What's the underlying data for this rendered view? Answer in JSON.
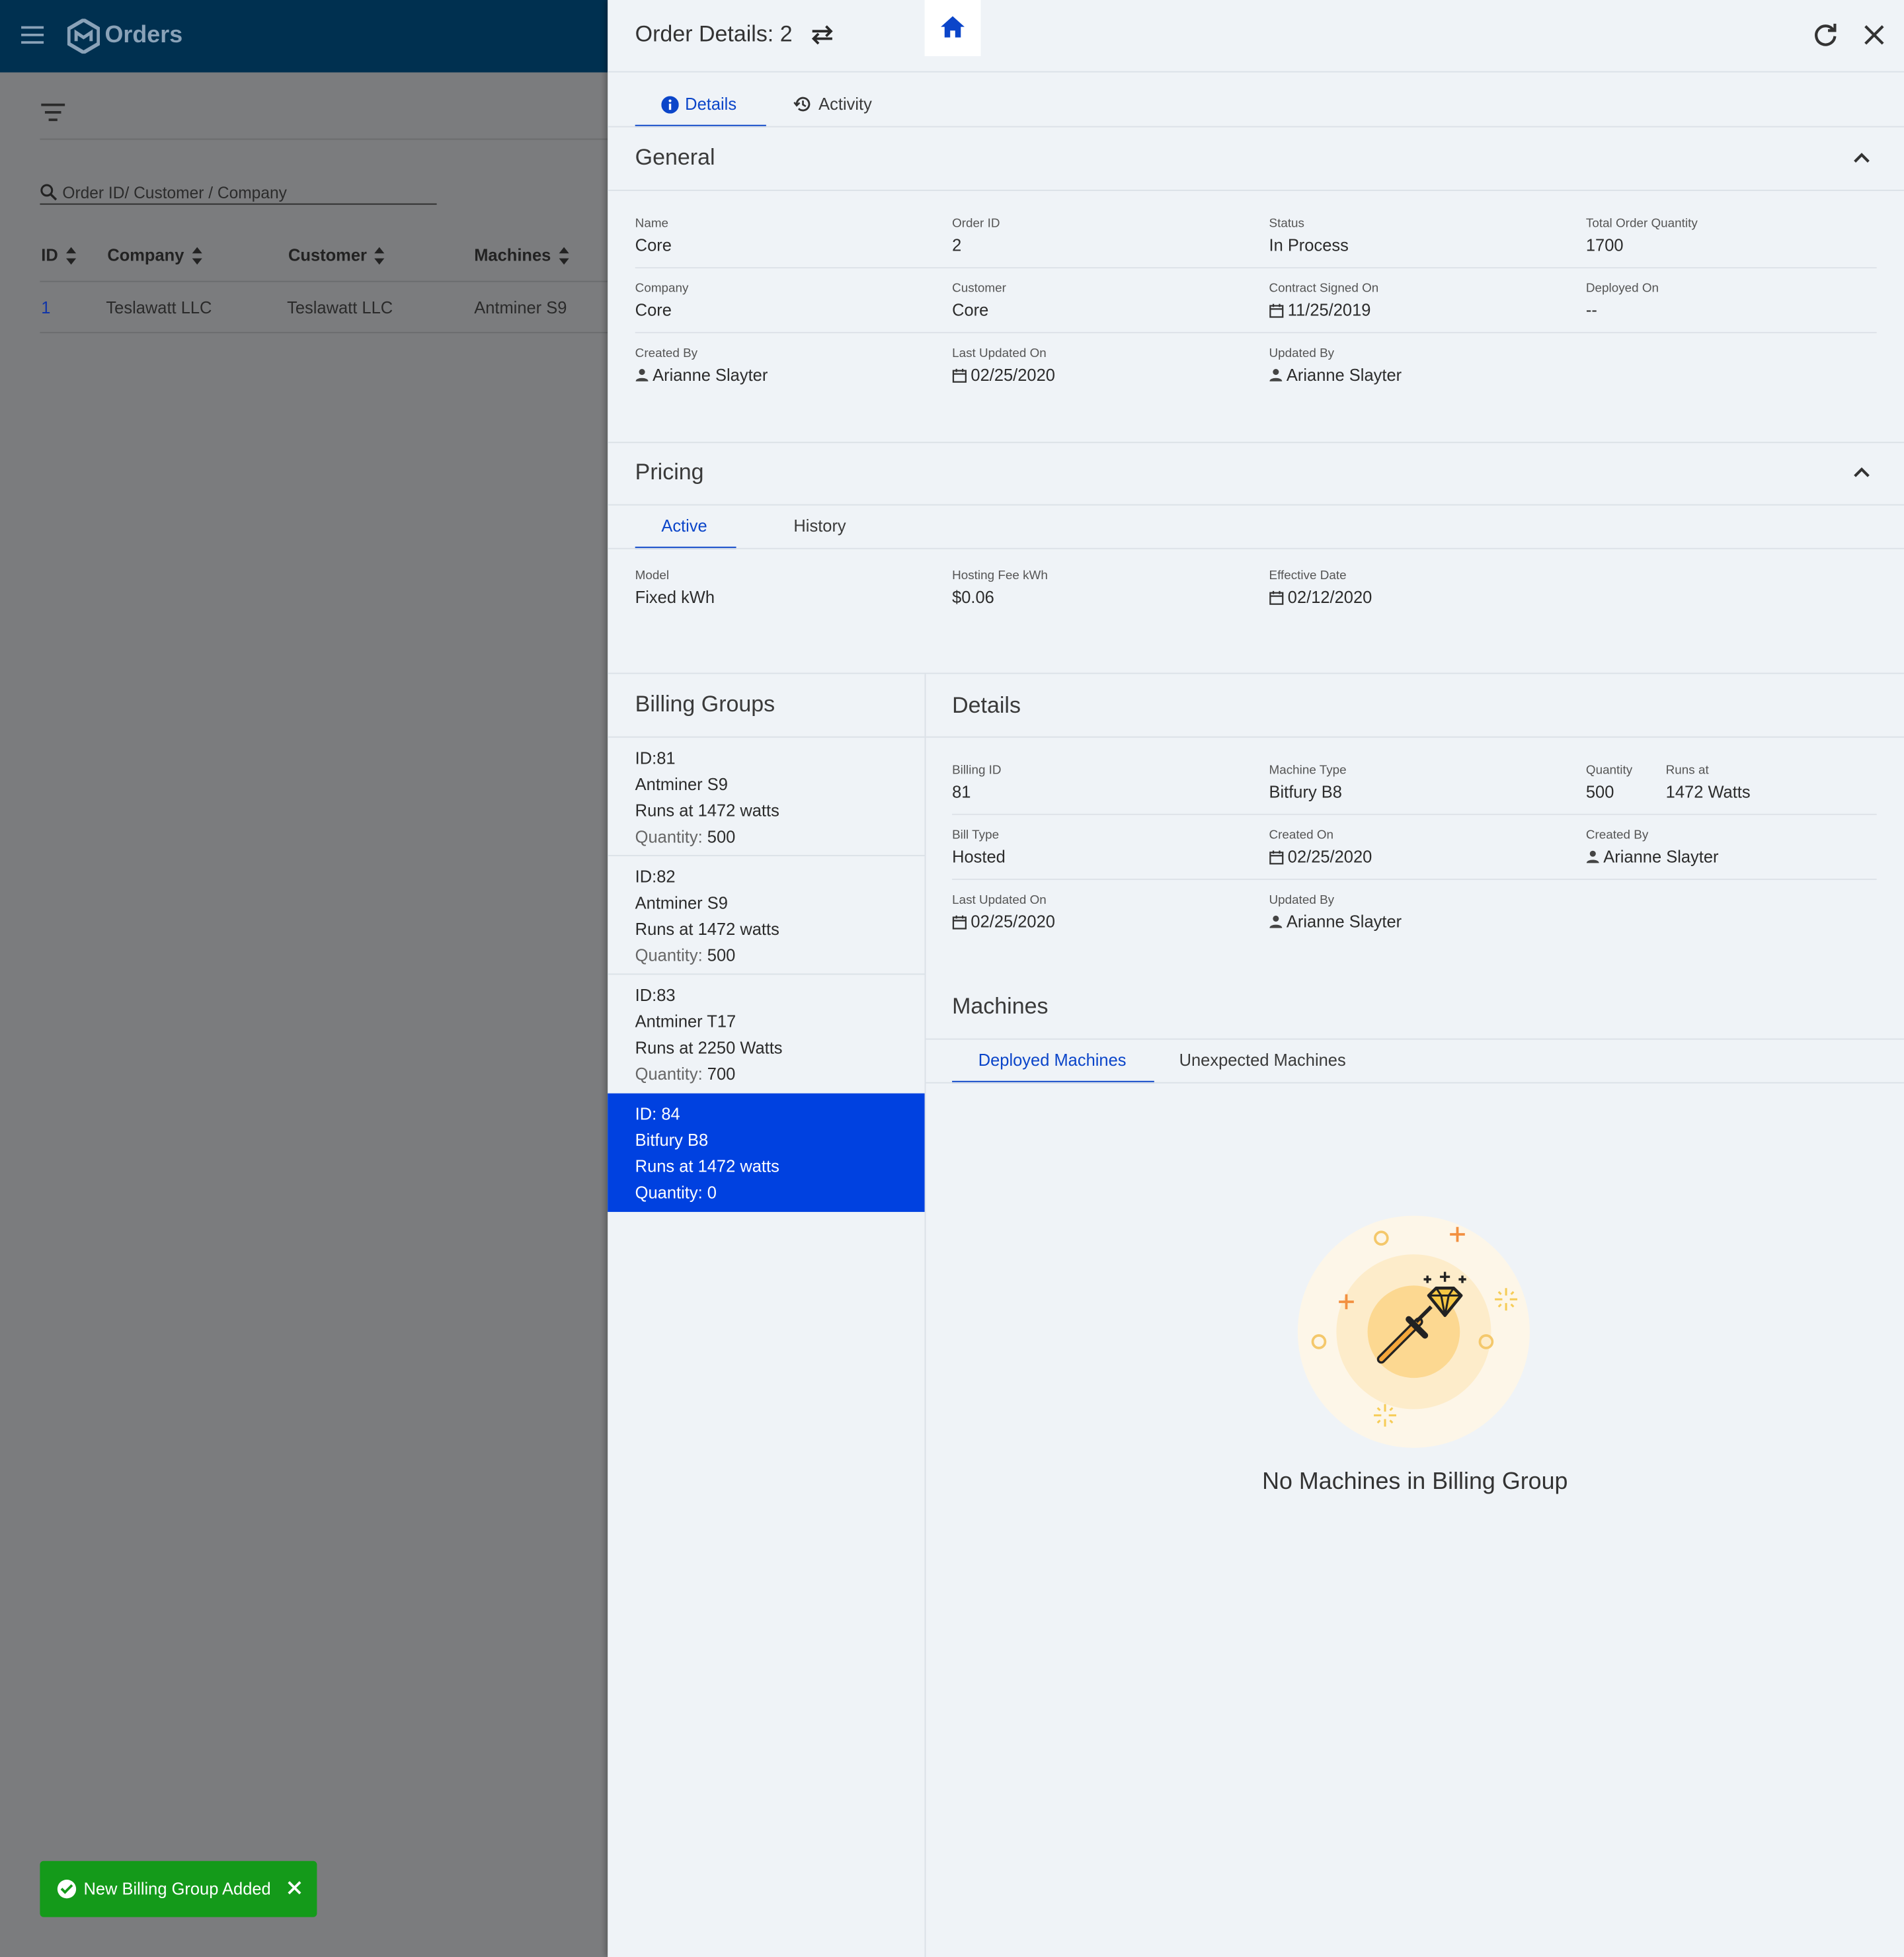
{
  "app": {
    "title": "Orders"
  },
  "search": {
    "placeholder": "Order ID/ Customer / Company"
  },
  "orders_table": {
    "columns": [
      "ID",
      "Company",
      "Customer",
      "Machines"
    ],
    "rows": [
      {
        "id": "1",
        "company": "Teslawatt LLC",
        "customer": "Teslawatt LLC",
        "machines": "Antminer S9"
      }
    ]
  },
  "toast": {
    "message": "New Billing Group Added"
  },
  "panel": {
    "title": "Order Details: 2",
    "tabs": {
      "details": "Details",
      "activity": "Activity"
    },
    "general": {
      "title": "General",
      "fields": {
        "name": {
          "label": "Name",
          "value": "Core"
        },
        "order_id": {
          "label": "Order ID",
          "value": "2"
        },
        "status": {
          "label": "Status",
          "value": "In Process"
        },
        "total_qty": {
          "label": "Total Order Quantity",
          "value": "1700"
        },
        "company": {
          "label": "Company",
          "value": "Core"
        },
        "customer": {
          "label": "Customer",
          "value": "Core"
        },
        "contract_signed": {
          "label": "Contract Signed On",
          "value": "11/25/2019"
        },
        "deployed_on": {
          "label": "Deployed On",
          "value": "--"
        },
        "created_by": {
          "label": "Created By",
          "value": "Arianne Slayter"
        },
        "last_updated": {
          "label": "Last Updated On",
          "value": "02/25/2020"
        },
        "updated_by": {
          "label": "Updated By",
          "value": "Arianne Slayter"
        }
      }
    },
    "pricing": {
      "title": "Pricing",
      "tabs": {
        "active": "Active",
        "history": "History"
      },
      "fields": {
        "model": {
          "label": "Model",
          "value": "Fixed kWh"
        },
        "hosting_fee": {
          "label": "Hosting Fee kWh",
          "value": "$0.06"
        },
        "effective_date": {
          "label": "Effective Date",
          "value": "02/12/2020"
        }
      }
    },
    "billing_groups": {
      "title": "Billing Groups",
      "quantity_label": "Quantity:",
      "items": [
        {
          "id": "ID:81",
          "machine": "Antminer S9",
          "runs": "Runs at 1472 watts",
          "quantity": "500",
          "selected": false
        },
        {
          "id": "ID:82",
          "machine": "Antminer S9",
          "runs": "Runs at 1472 watts",
          "quantity": "500",
          "selected": false
        },
        {
          "id": "ID:83",
          "machine": "Antminer T17",
          "runs": "Runs at 2250 Watts",
          "quantity": "700",
          "selected": false
        },
        {
          "id": "ID: 84",
          "machine": "Bitfury B8",
          "runs": "Runs at 1472 watts",
          "quantity": "0",
          "selected": true
        }
      ]
    },
    "details": {
      "title": "Details",
      "fields": {
        "billing_id": {
          "label": "Billing ID",
          "value": "81"
        },
        "machine_type": {
          "label": "Machine Type",
          "value": "Bitfury B8"
        },
        "quantity": {
          "label": "Quantity",
          "value": "500"
        },
        "runs_at": {
          "label": "Runs at",
          "value": "1472 Watts"
        },
        "bill_type": {
          "label": "Bill Type",
          "value": "Hosted"
        },
        "created_on": {
          "label": "Created On",
          "value": "02/25/2020"
        },
        "created_by": {
          "label": "Created By",
          "value": "Arianne Slayter"
        },
        "last_updated": {
          "label": "Last Updated On",
          "value": "02/25/2020"
        },
        "updated_by": {
          "label": "Updated By",
          "value": "Arianne Slayter"
        }
      }
    },
    "machines": {
      "title": "Machines",
      "tabs": {
        "deployed": "Deployed Machines",
        "unexpected": "Unexpected Machines"
      },
      "empty_message": "No Machines in Billing Group"
    }
  },
  "colors": {
    "header_bg": "#003050",
    "accent": "#0b45c9",
    "selected_bg": "#0041e0",
    "toast_bg": "#149a1a",
    "panel_bg": "#eff3f7",
    "overlay": "#7b7c7e"
  },
  "icons": [
    "menu-icon",
    "logo-icon",
    "filter-icon",
    "search-icon",
    "sort-icon",
    "check-circle-icon",
    "close-icon",
    "swap-icon",
    "home-icon",
    "refresh-icon",
    "info-icon",
    "history-icon",
    "chevron-up-icon",
    "calendar-icon",
    "person-icon",
    "pickaxe-diamond-illustration"
  ]
}
